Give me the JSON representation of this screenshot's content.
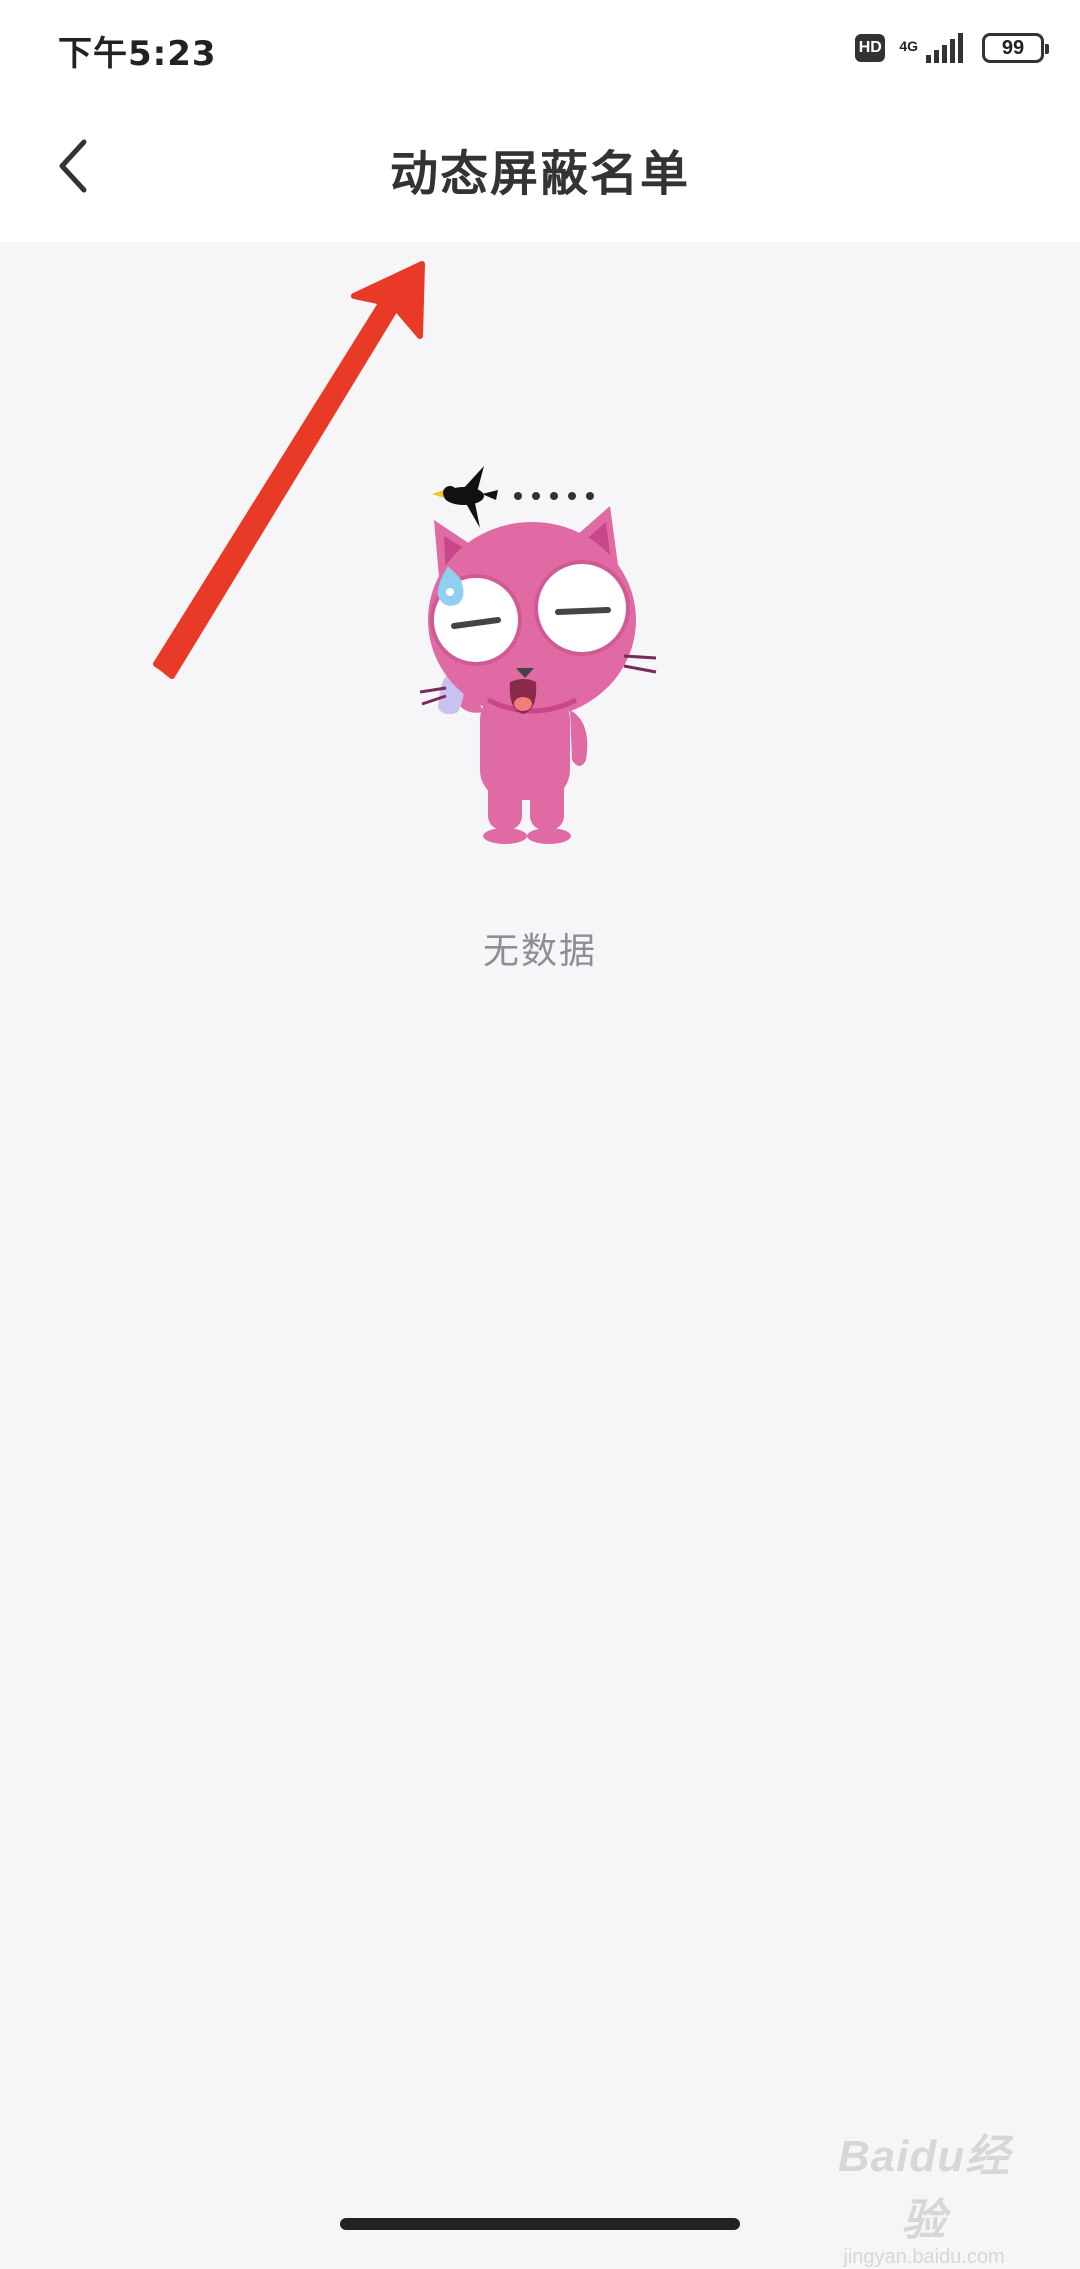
{
  "status_bar": {
    "time": "下午5:23",
    "hd_label": "HD",
    "network": "4G",
    "battery": "99"
  },
  "header": {
    "title": "动态屏蔽名单",
    "back_icon": "chevron-left-icon"
  },
  "empty_state": {
    "illustration": "pink-cat-with-crow-icon",
    "text": "无数据"
  },
  "annotation": {
    "arrow_color": "#e83a26"
  },
  "watermark": {
    "logo_text": "Baidu经验",
    "url": "jingyan.baidu.com"
  },
  "colors": {
    "background": "#f6f6f8",
    "header": "#ffffff",
    "cat_pink": "#e06aa3",
    "empty_text": "#8e8e93"
  }
}
